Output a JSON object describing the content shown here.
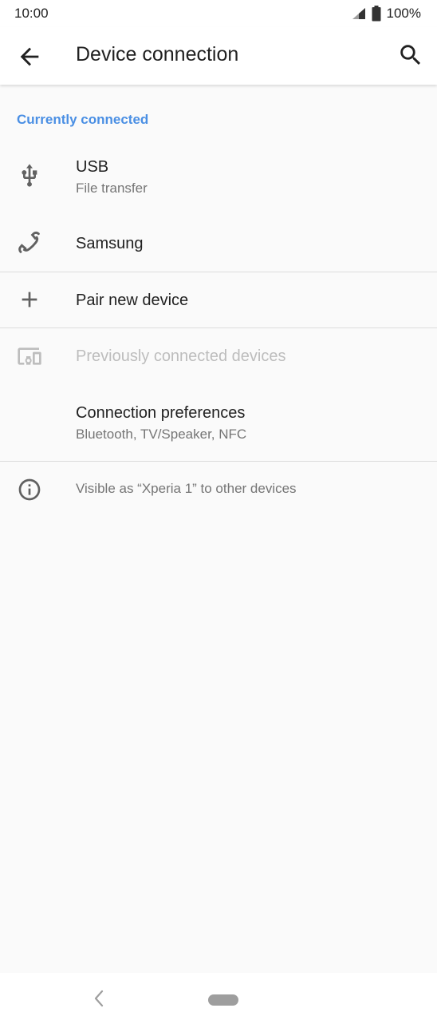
{
  "status_bar": {
    "time": "10:00",
    "battery": "100%",
    "icons": [
      "signal-icon",
      "battery-icon"
    ]
  },
  "app_bar": {
    "title": "Device connection",
    "back_icon": "arrow-back-icon",
    "search_icon": "search-icon"
  },
  "section": {
    "header": "Currently connected"
  },
  "items": {
    "usb": {
      "title": "USB",
      "subtitle": "File transfer",
      "icon": "usb-icon"
    },
    "samsung": {
      "title": "Samsung",
      "icon": "phone-icon"
    },
    "pair": {
      "title": "Pair new device",
      "icon": "plus-icon"
    },
    "previous": {
      "title": "Previously connected devices",
      "icon": "devices-icon"
    },
    "prefs": {
      "title": "Connection preferences",
      "subtitle": "Bluetooth, TV/Speaker, NFC"
    },
    "info": {
      "text": "Visible as “Xperia 1” to other devices",
      "icon": "info-icon"
    }
  },
  "colors": {
    "accent": "#4a8fe4",
    "background": "#fafafa",
    "disabled": "#bdbdbd"
  }
}
